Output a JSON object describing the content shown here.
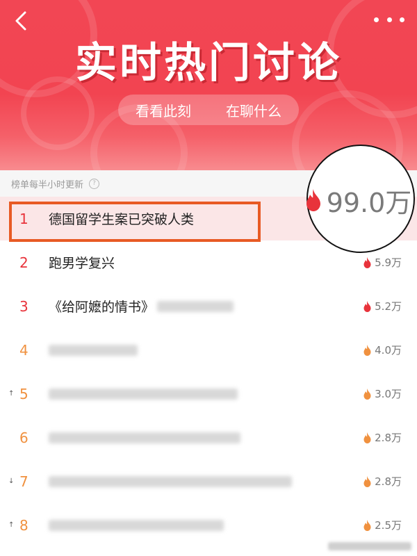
{
  "header": {
    "title": "实时热门讨论",
    "tabs": [
      {
        "label": "看看此刻"
      },
      {
        "label": "在聊什么"
      }
    ]
  },
  "update_bar": {
    "text": "榜单每半小时更新",
    "help_icon": "question-circle-icon"
  },
  "zoom": {
    "value": "99.0万"
  },
  "list": [
    {
      "rank": "1",
      "topic": "德国留学生案已突破人类",
      "heat": "",
      "highlight": true
    },
    {
      "rank": "2",
      "topic": "跑男学复兴",
      "heat": "5.9万"
    },
    {
      "rank": "3",
      "topic": "《给阿嬷的情书》",
      "heat": "5.2万"
    },
    {
      "rank": "4",
      "topic": "",
      "heat": "4.0万"
    },
    {
      "rank": "5",
      "topic": "",
      "heat": "3.0万"
    },
    {
      "rank": "6",
      "topic": "",
      "heat": "2.8万"
    },
    {
      "rank": "7",
      "topic": "",
      "heat": "2.8万"
    },
    {
      "rank": "8",
      "topic": "",
      "heat": "2.5万"
    }
  ],
  "colors": {
    "header_red": "#f24654",
    "rank_top": "#e8333b",
    "rank_other": "#f0913f",
    "highlight_bg": "#fbe6e7",
    "select_border": "#e85a24"
  },
  "icons": {
    "back": "chevron-left-icon",
    "more": "more-dots-icon",
    "flame": "flame-icon"
  }
}
